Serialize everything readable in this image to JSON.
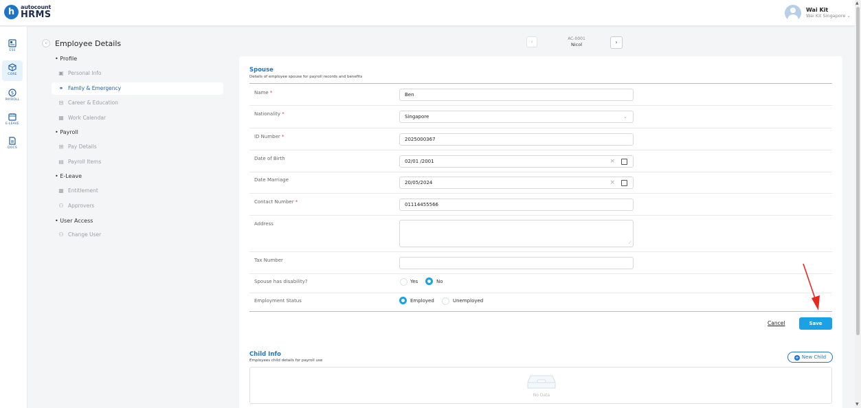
{
  "app": {
    "logo_top": "autocount",
    "logo_bottom": "HRMS",
    "logo_letter": "h"
  },
  "user": {
    "name": "Wai Kit",
    "company": "Wai Kit Singapore ⌄"
  },
  "rail": [
    {
      "label": "ESS",
      "icon": "ess-icon"
    },
    {
      "label": "CORE",
      "icon": "core-cube-icon",
      "active": true
    },
    {
      "label": "PAYROLL",
      "icon": "dollar-icon"
    },
    {
      "label": "E-LEAVE",
      "icon": "calendar-icon"
    },
    {
      "label": "DOCS",
      "icon": "document-icon"
    }
  ],
  "page": {
    "back_glyph": "‹",
    "title": "Employee Details"
  },
  "record": {
    "code": "AC-0001",
    "name": "Nicol",
    "prev_glyph": "‹",
    "next_glyph": "›"
  },
  "nav": {
    "groups": [
      "• Profile",
      "• Payroll",
      "• E-Leave",
      "• User Access"
    ],
    "items": [
      {
        "label": "Personal Info",
        "icon": "id-card-icon"
      },
      {
        "label": "Family & Emergency",
        "icon": "family-icon",
        "active": true
      },
      {
        "label": "Career & Education",
        "icon": "briefcase-icon"
      },
      {
        "label": "Work Calendar",
        "icon": "calendar-icon"
      },
      {
        "label": "Pay Details",
        "icon": "bank-icon"
      },
      {
        "label": "Payroll Items",
        "icon": "payroll-items-icon"
      },
      {
        "label": "Entitlement",
        "icon": "calendar-icon"
      },
      {
        "label": "Approvers",
        "icon": "users-icon"
      },
      {
        "label": "Change User",
        "icon": "users-icon"
      }
    ]
  },
  "spouse": {
    "title": "Spouse",
    "description": "Details of employee spouse for payroll records and benefits",
    "fields": {
      "name": {
        "label": "Name",
        "value": "Ben"
      },
      "nationality": {
        "label": "Nationality",
        "value": "Singapore"
      },
      "id_number": {
        "label": "ID Number",
        "value": "2025000367"
      },
      "dob": {
        "label": "Date of Birth",
        "value": "02/01 /2001"
      },
      "marriage": {
        "label": "Date Marriage",
        "value": "20/05/2024"
      },
      "contact": {
        "label": "Contact Number",
        "value": "01114455566"
      },
      "address": {
        "label": "Address",
        "value": ""
      },
      "tax": {
        "label": "Tax Number",
        "value": ""
      },
      "disability": {
        "label": "Spouse has disability?",
        "options": [
          "Yes",
          "No"
        ],
        "selected": "No"
      },
      "employment": {
        "label": "Employment Status",
        "options": [
          "Employed",
          "Unemployed"
        ],
        "selected": "Employed"
      }
    },
    "required_mark": "*",
    "clear_glyph": "×",
    "chevron_glyph": "⌄",
    "cancel_label": "Cancel",
    "save_label": "Save"
  },
  "child": {
    "title": "Child Info",
    "description": "Employees child details for payroll use",
    "new_label": "New Child",
    "plus_glyph": "+",
    "empty_text": "No Data"
  },
  "scroll": {
    "up": "▲",
    "down": "▼"
  },
  "colors": {
    "accent": "#1aa1e6",
    "brand": "#1f74c9",
    "annotation_arrow": "#e8281e"
  }
}
